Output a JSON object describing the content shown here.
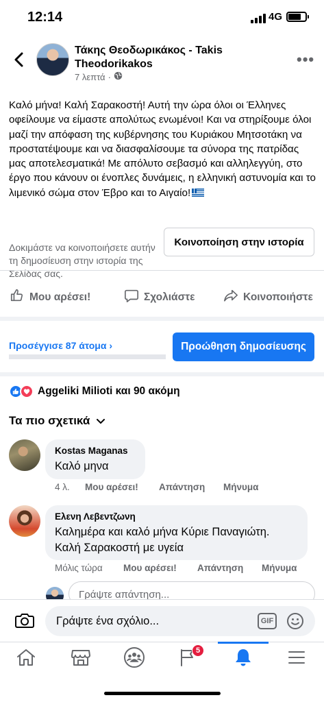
{
  "status_bar": {
    "time": "12:14",
    "network": "4G"
  },
  "post": {
    "author": "Τάκης Θεοδωρικάκος - Takis Theodorikakos",
    "time": "7 λεπτά",
    "text": "Καλό μήνα! Καλή Σαρακοστή! Αυτή την ώρα όλοι οι Έλληνες οφείλουμε να είμαστε απολύτως ενωμένοι! Και να στηρίξουμε όλοι μαζί την απόφαση της κυβέρνησης του Κυριάκου Μητσοτάκη να προστατέψουμε και να διασφαλίσουμε τα σύνορα της πατρίδας μας αποτελεσματικά! Με απόλυτο σεβασμό και αλληλεγγύη, στο έργο που κάνουν οι ένοπλες δυνάμεις, η ελληνική αστυνομία και το λιμενικό σώμα στον Έβρο και το Αιγαίο!",
    "share_hint": "Δοκιμάστε να κοινοποιήσετε αυτήν τη δημοσίευση στην ιστορία της Σελίδας σας.",
    "share_story_button": "Κοινοποίηση στην ιστορία"
  },
  "actions": {
    "like": "Μου αρέσει!",
    "comment": "Σχολιάστε",
    "share": "Κοινοποιήστε"
  },
  "promotion": {
    "reach": "Προσέγγισε 87 άτομα",
    "reach_fraction": 0,
    "button": "Προώθηση δημοσίευσης"
  },
  "reactions": {
    "summary": "Aggeliki Milioti και 90 ακόμη"
  },
  "comments_filter": "Τα πιο σχετικά",
  "comments": [
    {
      "name": "Kostas Maganas",
      "text": "Καλό μηνα",
      "time": "4 λ.",
      "like": "Μου αρέσει!",
      "reply": "Απάντηση",
      "message": "Μήνυμα"
    },
    {
      "name": "Ελενη Λεβεντζωνη",
      "text": "Καλημέρα και καλό μήνα Κύριε Παναγιώτη. Καλή Σαρακοστή με υγεία",
      "time": "Μόλις τώρα",
      "like": "Μου αρέσει!",
      "reply": "Απάντηση",
      "message": "Μήνυμα"
    }
  ],
  "reply_placeholder": "Γράψτε απάντηση...",
  "composer": {
    "placeholder": "Γράψτε ένα σχόλιο...",
    "gif": "GIF"
  },
  "tabbar": {
    "notifications_badge": "5"
  },
  "colors": {
    "accent": "#1877f2",
    "badge": "#e41e3f",
    "secondary_text": "#65676b"
  }
}
